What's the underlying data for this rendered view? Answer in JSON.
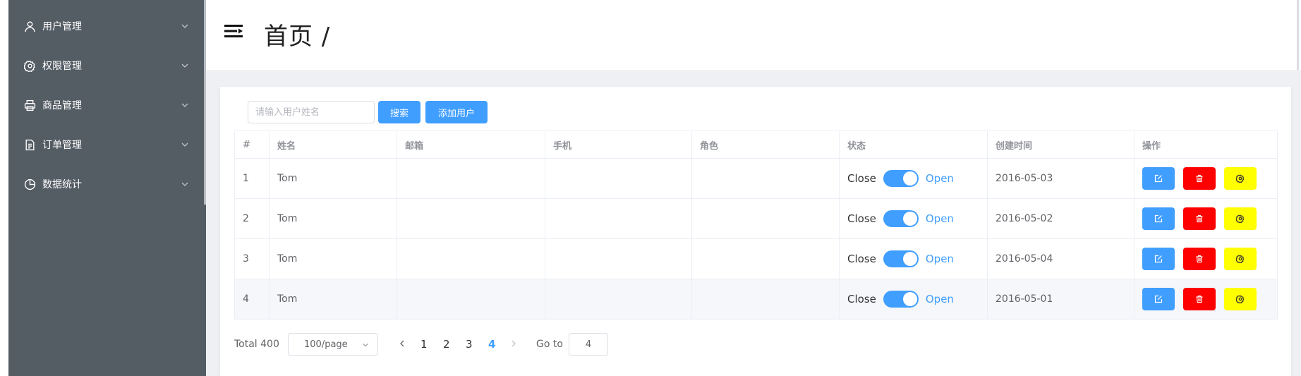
{
  "sidebar": {
    "items": [
      {
        "label": "用户管理",
        "icon": "user-icon"
      },
      {
        "label": "权限管理",
        "icon": "gear-icon"
      },
      {
        "label": "商品管理",
        "icon": "printer-icon"
      },
      {
        "label": "订单管理",
        "icon": "document-icon"
      },
      {
        "label": "数据统计",
        "icon": "pie-chart-icon"
      }
    ]
  },
  "header": {
    "title": "首页 /"
  },
  "toolbar": {
    "search_placeholder": "请输入用户姓名",
    "search_value": "",
    "search_label": "搜索",
    "add_label": "添加用户"
  },
  "table": {
    "columns": [
      "#",
      "姓名",
      "邮箱",
      "手机",
      "角色",
      "状态",
      "创建时间",
      "操作"
    ],
    "switch_off_text": "Close",
    "switch_on_text": "Open",
    "rows": [
      {
        "index": "1",
        "name": "Tom",
        "email": "",
        "phone": "",
        "role": "",
        "status": true,
        "created": "2016-05-03"
      },
      {
        "index": "2",
        "name": "Tom",
        "email": "",
        "phone": "",
        "role": "",
        "status": true,
        "created": "2016-05-02"
      },
      {
        "index": "3",
        "name": "Tom",
        "email": "",
        "phone": "",
        "role": "",
        "status": true,
        "created": "2016-05-04"
      },
      {
        "index": "4",
        "name": "Tom",
        "email": "",
        "phone": "",
        "role": "",
        "status": true,
        "created": "2016-05-01"
      }
    ]
  },
  "pagination": {
    "total": "Total 400",
    "page_size": "100/page",
    "pages": [
      "1",
      "2",
      "3",
      "4"
    ],
    "current": "4",
    "goto_label": "Go to",
    "goto_value": "4"
  },
  "colors": {
    "sidebar_bg": "#545c64",
    "primary": "#409eff",
    "danger": "#ff0000",
    "warning": "#ffff00"
  }
}
